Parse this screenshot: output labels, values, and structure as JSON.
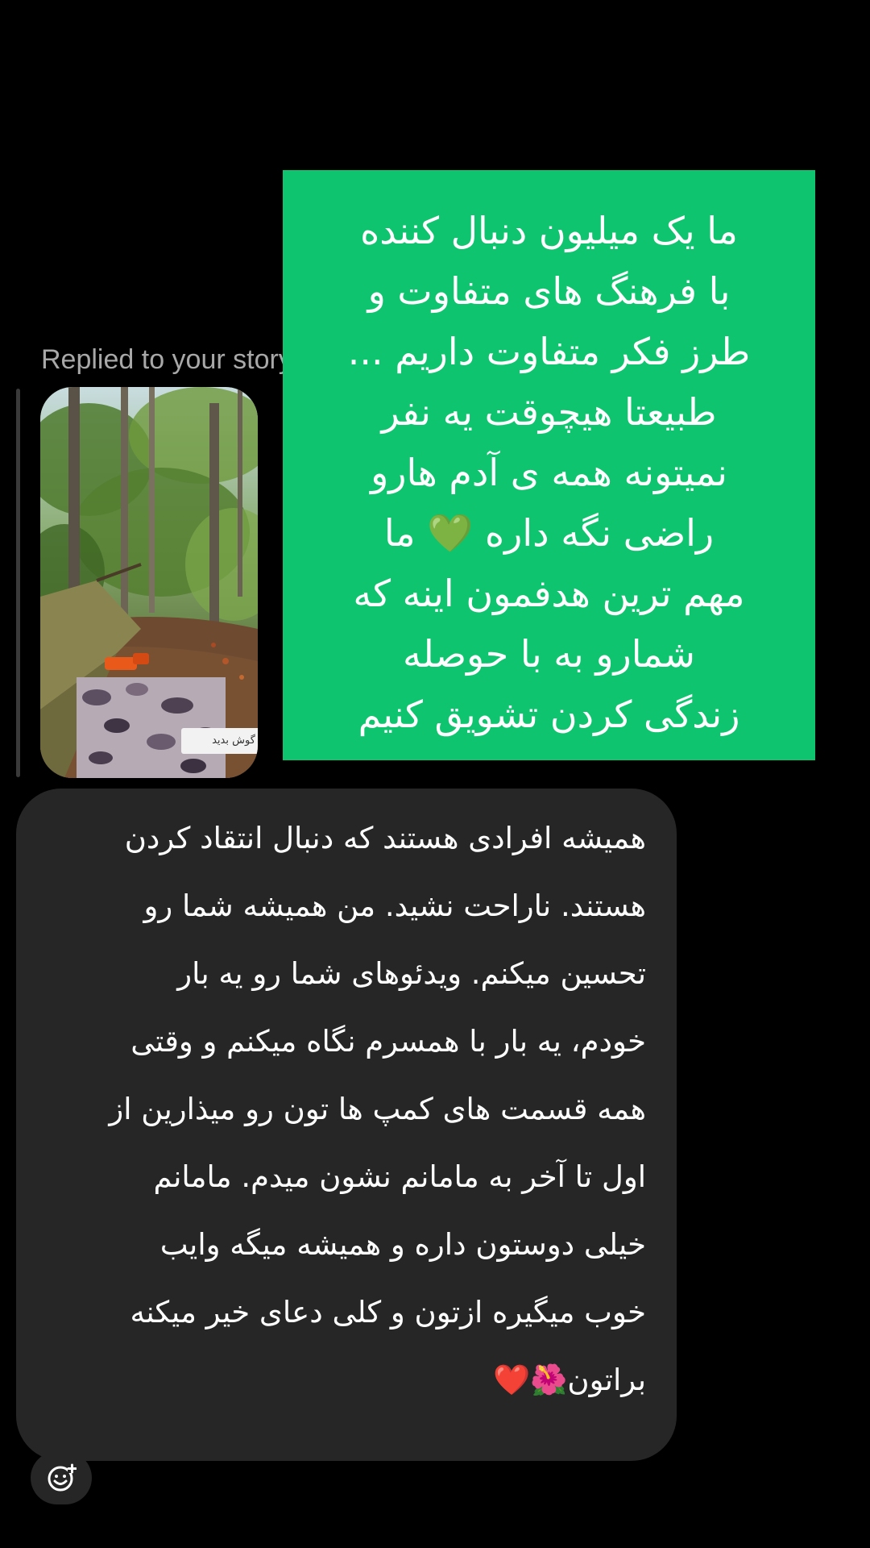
{
  "reply": {
    "label": "Replied to your story"
  },
  "story": {
    "sticker_text": "گوش بدید"
  },
  "green_card": {
    "lines": [
      "ما یک میلیون دنبال کننده",
      "با فرهنگ های متفاوت و",
      "طرز فکر متفاوت داریم ...",
      "طبیعتا هیچوقت یه نفر",
      "نمیتونه همه ی آدم هارو",
      "راضی نگه داره 💚  ما",
      "مهم ترین هدفمون اینه که",
      "شمارو به با حوصله",
      "زندگی کردن تشویق کنیم"
    ],
    "background": "#0fc46f"
  },
  "message": {
    "lines": [
      "همیشه افرادی هستند که دنبال انتقاد کردن",
      "هستند. ناراحت نشید. من همیشه شما رو",
      "تحسین میکنم. ویدئوهای شما رو یه بار",
      "خودم، یه بار با همسرم نگاه میکنم و وقتی",
      "همه قسمت های کمپ ها تون رو میذارین از",
      "اول تا آخر به مامانم نشون میدم.  مامانم",
      "خیلی دوستون داره و همیشه میگه وایب",
      "خوب میگیره ازتون و کلی دعای خیر میکنه",
      "براتون🌺❤️"
    ],
    "bubble_color": "#262626"
  },
  "reaction_button": {
    "icon": "add-reaction-icon"
  }
}
